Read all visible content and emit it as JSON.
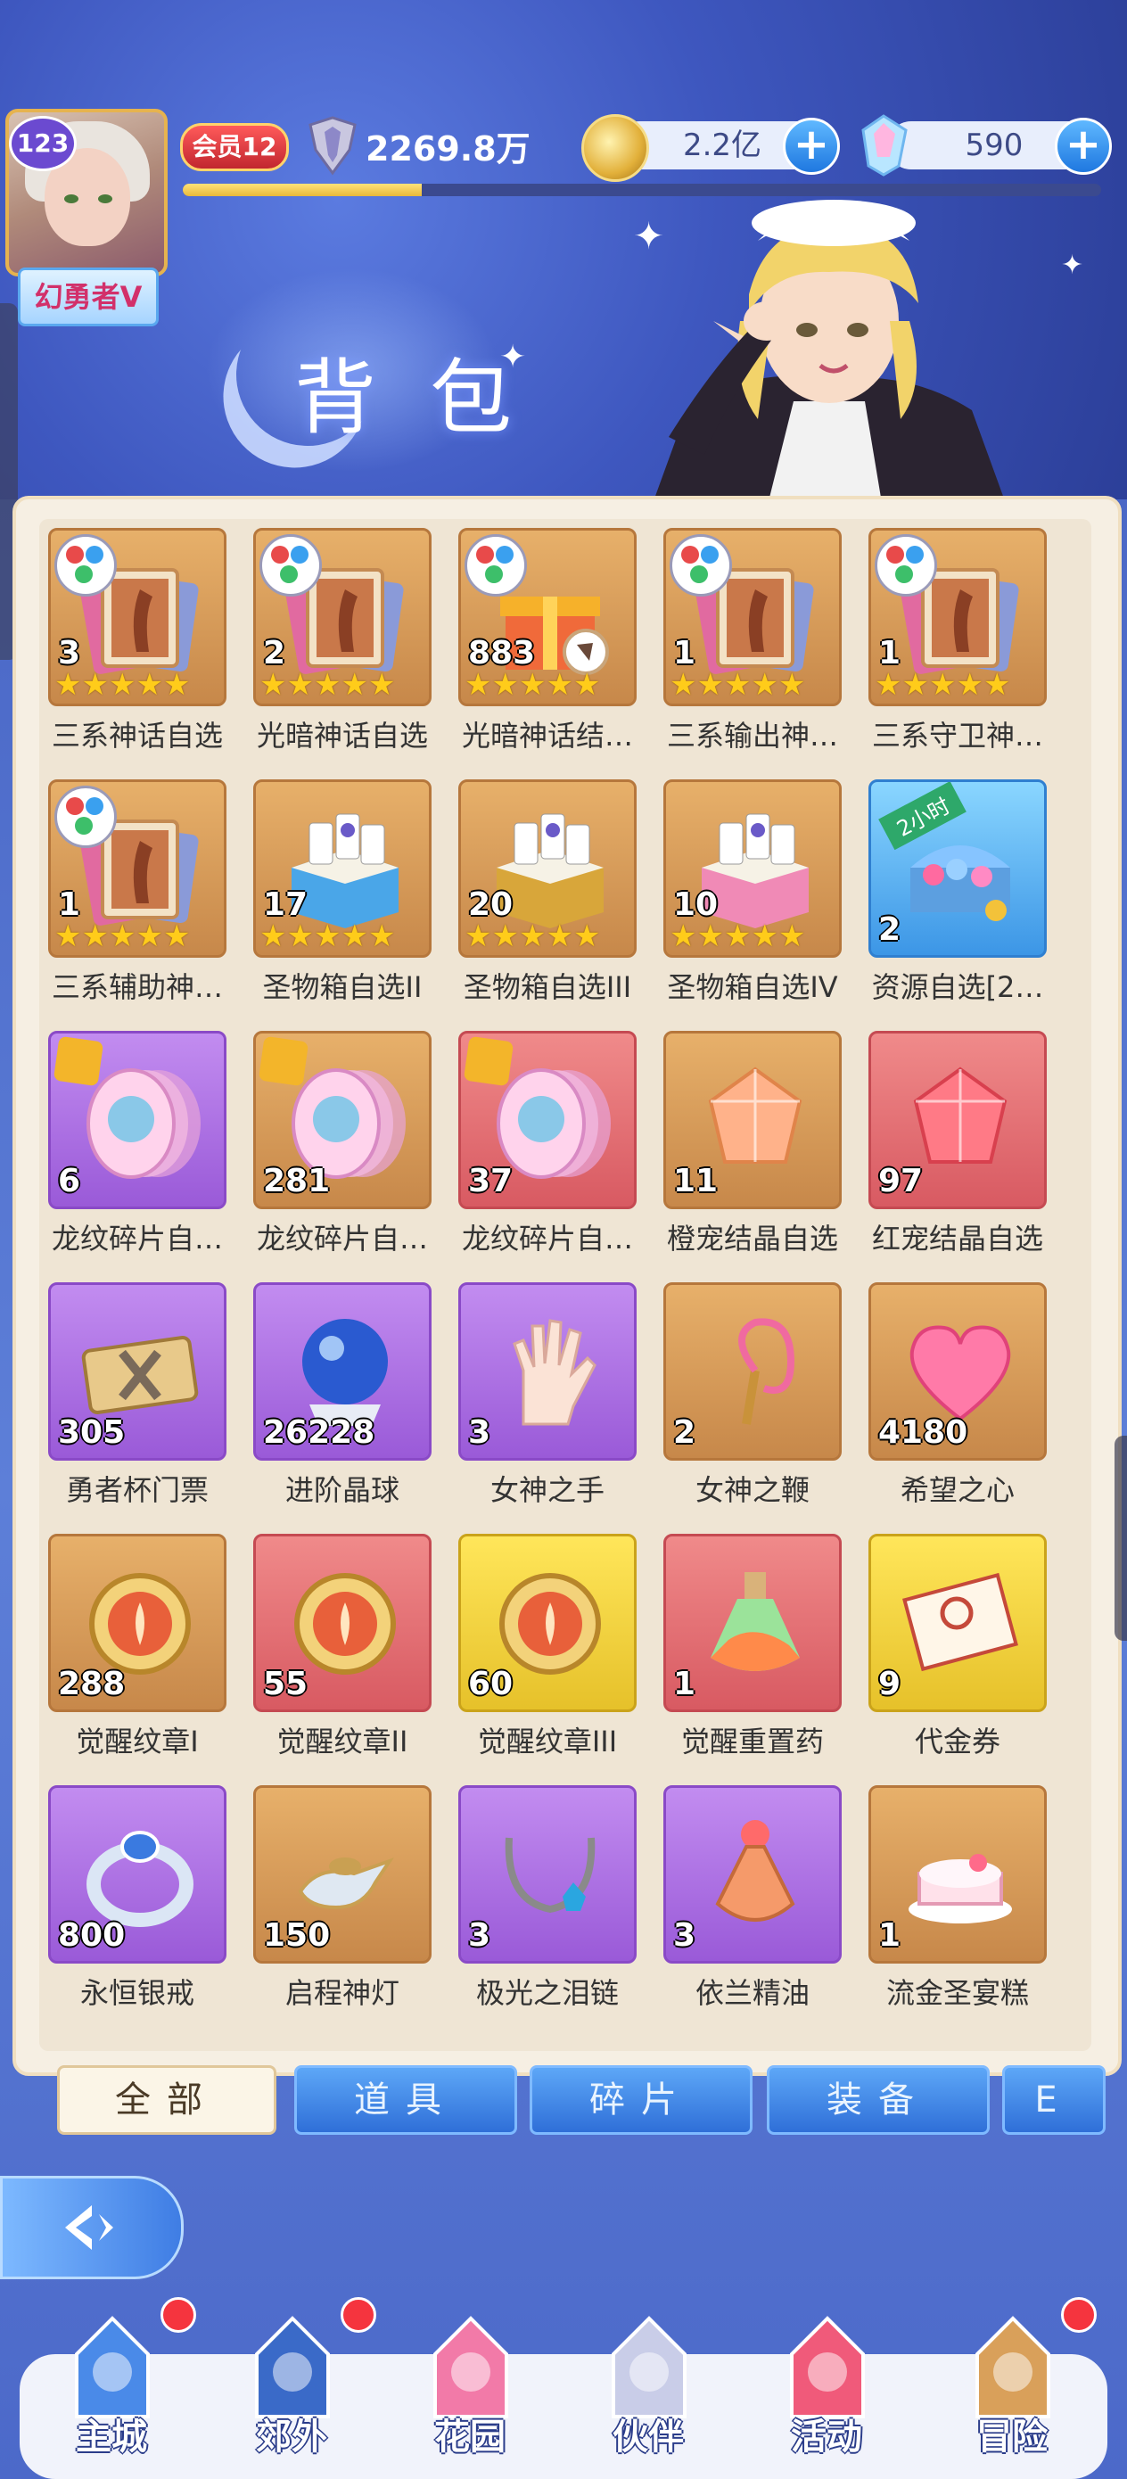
{
  "header": {
    "title": "背包",
    "player_level": "123",
    "player_title": "幻勇者V",
    "vip": "会员12",
    "power": "2269.8万",
    "exp_fraction": 0.26,
    "gold": "2.2亿",
    "diamonds": "590"
  },
  "items": [
    {
      "label": "三系神话自选",
      "count": "3",
      "stars": 5,
      "frame": "orange",
      "icon": "card-three-element-icon"
    },
    {
      "label": "光暗神话自选",
      "count": "2",
      "stars": 5,
      "frame": "orange",
      "icon": "card-light-dark-icon"
    },
    {
      "label": "光暗神话结…",
      "count": "883",
      "stars": 5,
      "frame": "orange",
      "icon": "gift-box-icon"
    },
    {
      "label": "三系输出神…",
      "count": "1",
      "stars": 5,
      "frame": "orange",
      "icon": "card-three-element-icon"
    },
    {
      "label": "三系守卫神…",
      "count": "1",
      "stars": 5,
      "frame": "orange",
      "icon": "card-three-element-icon"
    },
    {
      "label": "三系辅助神…",
      "count": "1",
      "stars": 5,
      "frame": "orange",
      "icon": "card-three-element-icon"
    },
    {
      "label": "圣物箱自选II",
      "count": "17",
      "stars": 5,
      "frame": "orange",
      "icon": "relic-box-blue-icon"
    },
    {
      "label": "圣物箱自选III",
      "count": "20",
      "stars": 5,
      "frame": "orange",
      "icon": "relic-box-gold-icon"
    },
    {
      "label": "圣物箱自选IV",
      "count": "10",
      "stars": 5,
      "frame": "orange",
      "icon": "relic-box-pink-icon"
    },
    {
      "label": "资源自选[2…",
      "count": "2",
      "stars": 0,
      "frame": "blue",
      "icon": "treasure-chest-icon",
      "ribbon": "2小时"
    },
    {
      "label": "龙纹碎片自…",
      "count": "6",
      "stars": 0,
      "frame": "purple",
      "icon": "fragment-stack-icon"
    },
    {
      "label": "龙纹碎片自…",
      "count": "281",
      "stars": 0,
      "frame": "orange",
      "icon": "fragment-stack-icon"
    },
    {
      "label": "龙纹碎片自…",
      "count": "37",
      "stars": 0,
      "frame": "red",
      "icon": "fragment-stack-icon"
    },
    {
      "label": "橙宠结晶自选",
      "count": "11",
      "stars": 0,
      "frame": "orange",
      "icon": "orange-crystal-icon"
    },
    {
      "label": "红宠结晶自选",
      "count": "97",
      "stars": 0,
      "frame": "red",
      "icon": "red-crystal-icon"
    },
    {
      "label": "勇者杯门票",
      "count": "305",
      "stars": 0,
      "frame": "purple",
      "icon": "ticket-icon"
    },
    {
      "label": "进阶晶球",
      "count": "26228",
      "stars": 0,
      "frame": "purple",
      "icon": "crystal-ball-icon"
    },
    {
      "label": "女神之手",
      "count": "3",
      "stars": 0,
      "frame": "purple",
      "icon": "hand-icon"
    },
    {
      "label": "女神之鞭",
      "count": "2",
      "stars": 0,
      "frame": "orange",
      "icon": "whip-icon"
    },
    {
      "label": "希望之心",
      "count": "4180",
      "stars": 0,
      "frame": "orange",
      "icon": "heart-icon"
    },
    {
      "label": "觉醒纹章I",
      "count": "288",
      "stars": 0,
      "frame": "orange",
      "icon": "emblem-icon"
    },
    {
      "label": "觉醒纹章II",
      "count": "55",
      "stars": 0,
      "frame": "red",
      "icon": "emblem-icon"
    },
    {
      "label": "觉醒纹章III",
      "count": "60",
      "stars": 0,
      "frame": "gold",
      "icon": "emblem-icon"
    },
    {
      "label": "觉醒重置药",
      "count": "1",
      "stars": 0,
      "frame": "red",
      "icon": "potion-icon"
    },
    {
      "label": "代金券",
      "count": "9",
      "stars": 0,
      "frame": "gold",
      "icon": "voucher-icon"
    },
    {
      "label": "永恒银戒",
      "count": "800",
      "stars": 0,
      "frame": "purple",
      "icon": "ring-icon"
    },
    {
      "label": "启程神灯",
      "count": "150",
      "stars": 0,
      "frame": "orange",
      "icon": "magic-lamp-icon"
    },
    {
      "label": "极光之泪链",
      "count": "3",
      "stars": 0,
      "frame": "purple",
      "icon": "necklace-icon"
    },
    {
      "label": "依兰精油",
      "count": "3",
      "stars": 0,
      "frame": "purple",
      "icon": "oil-bottle-icon"
    },
    {
      "label": "流金圣宴糕",
      "count": "1",
      "stars": 0,
      "frame": "orange",
      "icon": "cake-icon"
    }
  ],
  "tabs": [
    {
      "label": "全部",
      "active": true
    },
    {
      "label": "道具",
      "active": false
    },
    {
      "label": "碎片",
      "active": false
    },
    {
      "label": "装备",
      "active": false
    },
    {
      "label": "E",
      "active": false
    }
  ],
  "nav": [
    {
      "label": "主城",
      "badge": true,
      "icon": "castle-icon"
    },
    {
      "label": "郊外",
      "badge": true,
      "icon": "portal-icon"
    },
    {
      "label": "花园",
      "badge": false,
      "icon": "garden-heart-icon"
    },
    {
      "label": "伙伴",
      "badge": false,
      "icon": "partner-face-icon"
    },
    {
      "label": "活动",
      "badge": false,
      "icon": "gift-icon"
    },
    {
      "label": "冒险",
      "badge": true,
      "icon": "compass-icon"
    }
  ],
  "colors": {
    "accent": "#2f6fd8",
    "panel": "#f6efe3",
    "badge": "#f5343e"
  }
}
